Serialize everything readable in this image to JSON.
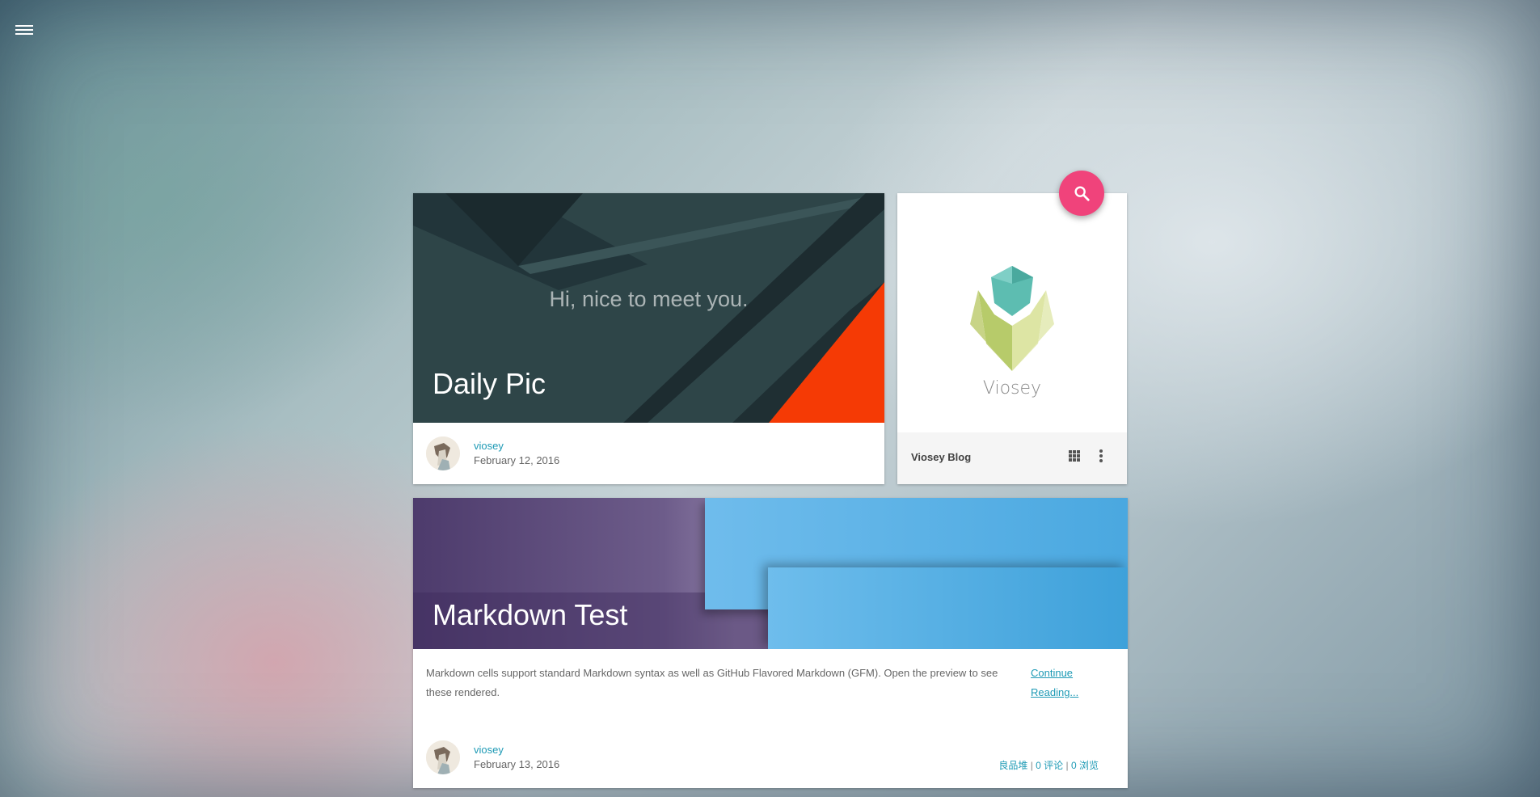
{
  "nav": {
    "menu_icon": "hamburger-menu-icon"
  },
  "daily_pic": {
    "hero_text": "Hi, nice to meet you.",
    "title": "Daily Pic",
    "author": "viosey",
    "date": "February 12, 2016",
    "colors": {
      "dark": "#2e4548",
      "accent": "#f53a05"
    }
  },
  "blog_card": {
    "logo_text": "Viosey",
    "name": "Viosey Blog",
    "apps_icon": "apps-grid-icon",
    "more_icon": "more-vert-icon"
  },
  "search_fab": {
    "icon": "search-icon",
    "color": "#f0437b"
  },
  "markdown_post": {
    "title": "Markdown Test",
    "excerpt": "Markdown cells support standard Markdown syntax as well as GitHub Flavored Markdown (GFM). Open the preview to see these rendered.",
    "continue_label": "Continue Reading...",
    "author": "viosey",
    "date": "February 13, 2016",
    "category": "良品堆",
    "comments": "0 评论",
    "views": "0 浏览",
    "separator": "|"
  }
}
